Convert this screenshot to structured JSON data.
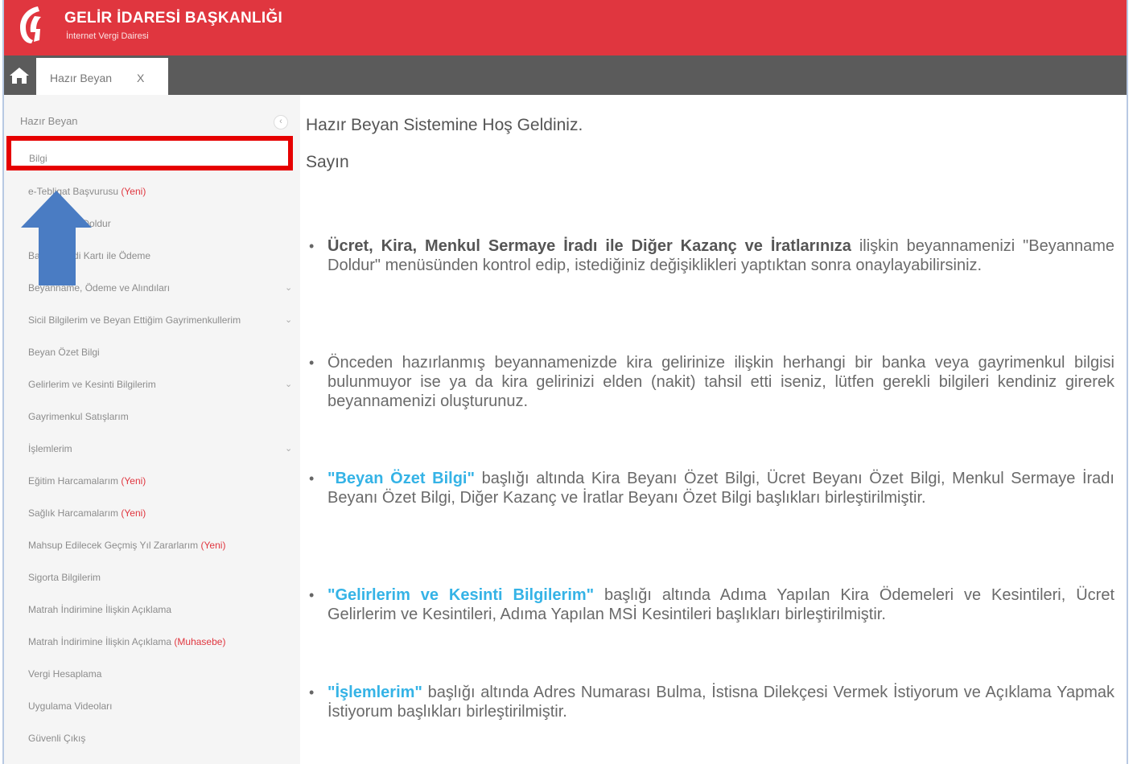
{
  "header": {
    "title": "GELİR İDARESİ BAŞKANLIĞI",
    "subtitle": "İnternet Vergi Dairesi"
  },
  "tabs": [
    {
      "label": "Hazır Beyan",
      "close": "X"
    }
  ],
  "sidebar": {
    "heading": "Hazır Beyan",
    "toggle": "‹",
    "highlighted_item": "Bilgi",
    "items": [
      {
        "label": "e-Tebligat Başvurusu",
        "badge": "(Yeni)"
      },
      {
        "label": "Beyanname Doldur",
        "badge": ""
      },
      {
        "label": "Banka/Kredi Kartı ile Ödeme",
        "badge": ""
      },
      {
        "label": "Beyanname, Ödeme ve Alındıları",
        "badge": ""
      },
      {
        "label": "Sicil Bilgilerim ve Beyan Ettiğim Gayrimenkullerim",
        "badge": ""
      },
      {
        "label": "Beyan Özet Bilgi",
        "badge": ""
      },
      {
        "label": "Gelirlerim ve Kesinti Bilgilerim",
        "badge": ""
      },
      {
        "label": "Gayrimenkul Satışlarım",
        "badge": ""
      },
      {
        "label": "İşlemlerim",
        "badge": ""
      },
      {
        "label": "Eğitim Harcamalarım",
        "badge": "(Yeni)"
      },
      {
        "label": "Sağlık Harcamalarım",
        "badge": "(Yeni)"
      },
      {
        "label": "Mahsup Edilecek Geçmiş Yıl Zararlarım",
        "badge": "(Yeni)"
      },
      {
        "label": "Sigorta Bilgilerim",
        "badge": ""
      },
      {
        "label": "Matrah İndirimine İlişkin Açıklama",
        "badge": ""
      },
      {
        "label": "Matrah İndirimine İlişkin Açıklama",
        "badge": "(Muhasebe)"
      },
      {
        "label": "Vergi Hesaplama",
        "badge": ""
      },
      {
        "label": "Uygulama Videoları",
        "badge": ""
      },
      {
        "label": "Güvenli Çıkış",
        "badge": ""
      }
    ]
  },
  "main": {
    "welcome": "Hazır Beyan Sistemine Hoş Geldiniz.",
    "greeting": "Sayın",
    "bullet_char": "•",
    "p1_bold": "Ücret, Kira, Menkul Sermaye İradı ile Diğer Kazanç ve İratlarınıza",
    "p1_text": " ilişkin beyannamenizi \"Beyanname Doldur\" menüsünden kontrol edip, istediğiniz değişiklikleri yaptıktan sonra onaylayabilirsiniz.",
    "p2_text": "Önceden hazırlanmış beyannamenizde kira gelirinize ilişkin herhangi bir banka veya gayrimenkul bilgisi bulunmuyor ise ya da kira gelirinizi elden (nakit) tahsil etti iseniz, lütfen gerekli bilgileri kendiniz girerek beyannamenizi oluşturunuz.",
    "p3_link": "\"Beyan Özet Bilgi\"",
    "p3_text": " başlığı altında Kira Beyanı Özet Bilgi, Ücret Beyanı Özet Bilgi, Menkul Sermaye İradı Beyanı Özet Bilgi, Diğer Kazanç ve İratlar Beyanı Özet Bilgi başlıkları birleştirilmiştir.",
    "p4_link": "\"Gelirlerim ve Kesinti Bilgilerim\"",
    "p4_text": " başlığı altında Adıma Yapılan Kira Ödemeleri ve Kesintileri, Ücret Gelirlerim ve Kesintileri, Adıma Yapılan MSİ Kesintileri başlıkları birleştirilmiştir.",
    "p5_link": "\"İşlemlerim\"",
    "p5_text": " başlığı altında Adres Numarası Bulma, İstisna Dilekçesi Vermek İstiyorum ve Açıklama Yapmak İstiyorum başlıkları birleştirilmiştir."
  },
  "colors": {
    "header_red": "#e0363f",
    "tabbar_gray": "#5b5b5b",
    "link_blue": "#35b3e6",
    "highlight_red": "#e60000",
    "arrow_blue": "#4a7cc3"
  }
}
